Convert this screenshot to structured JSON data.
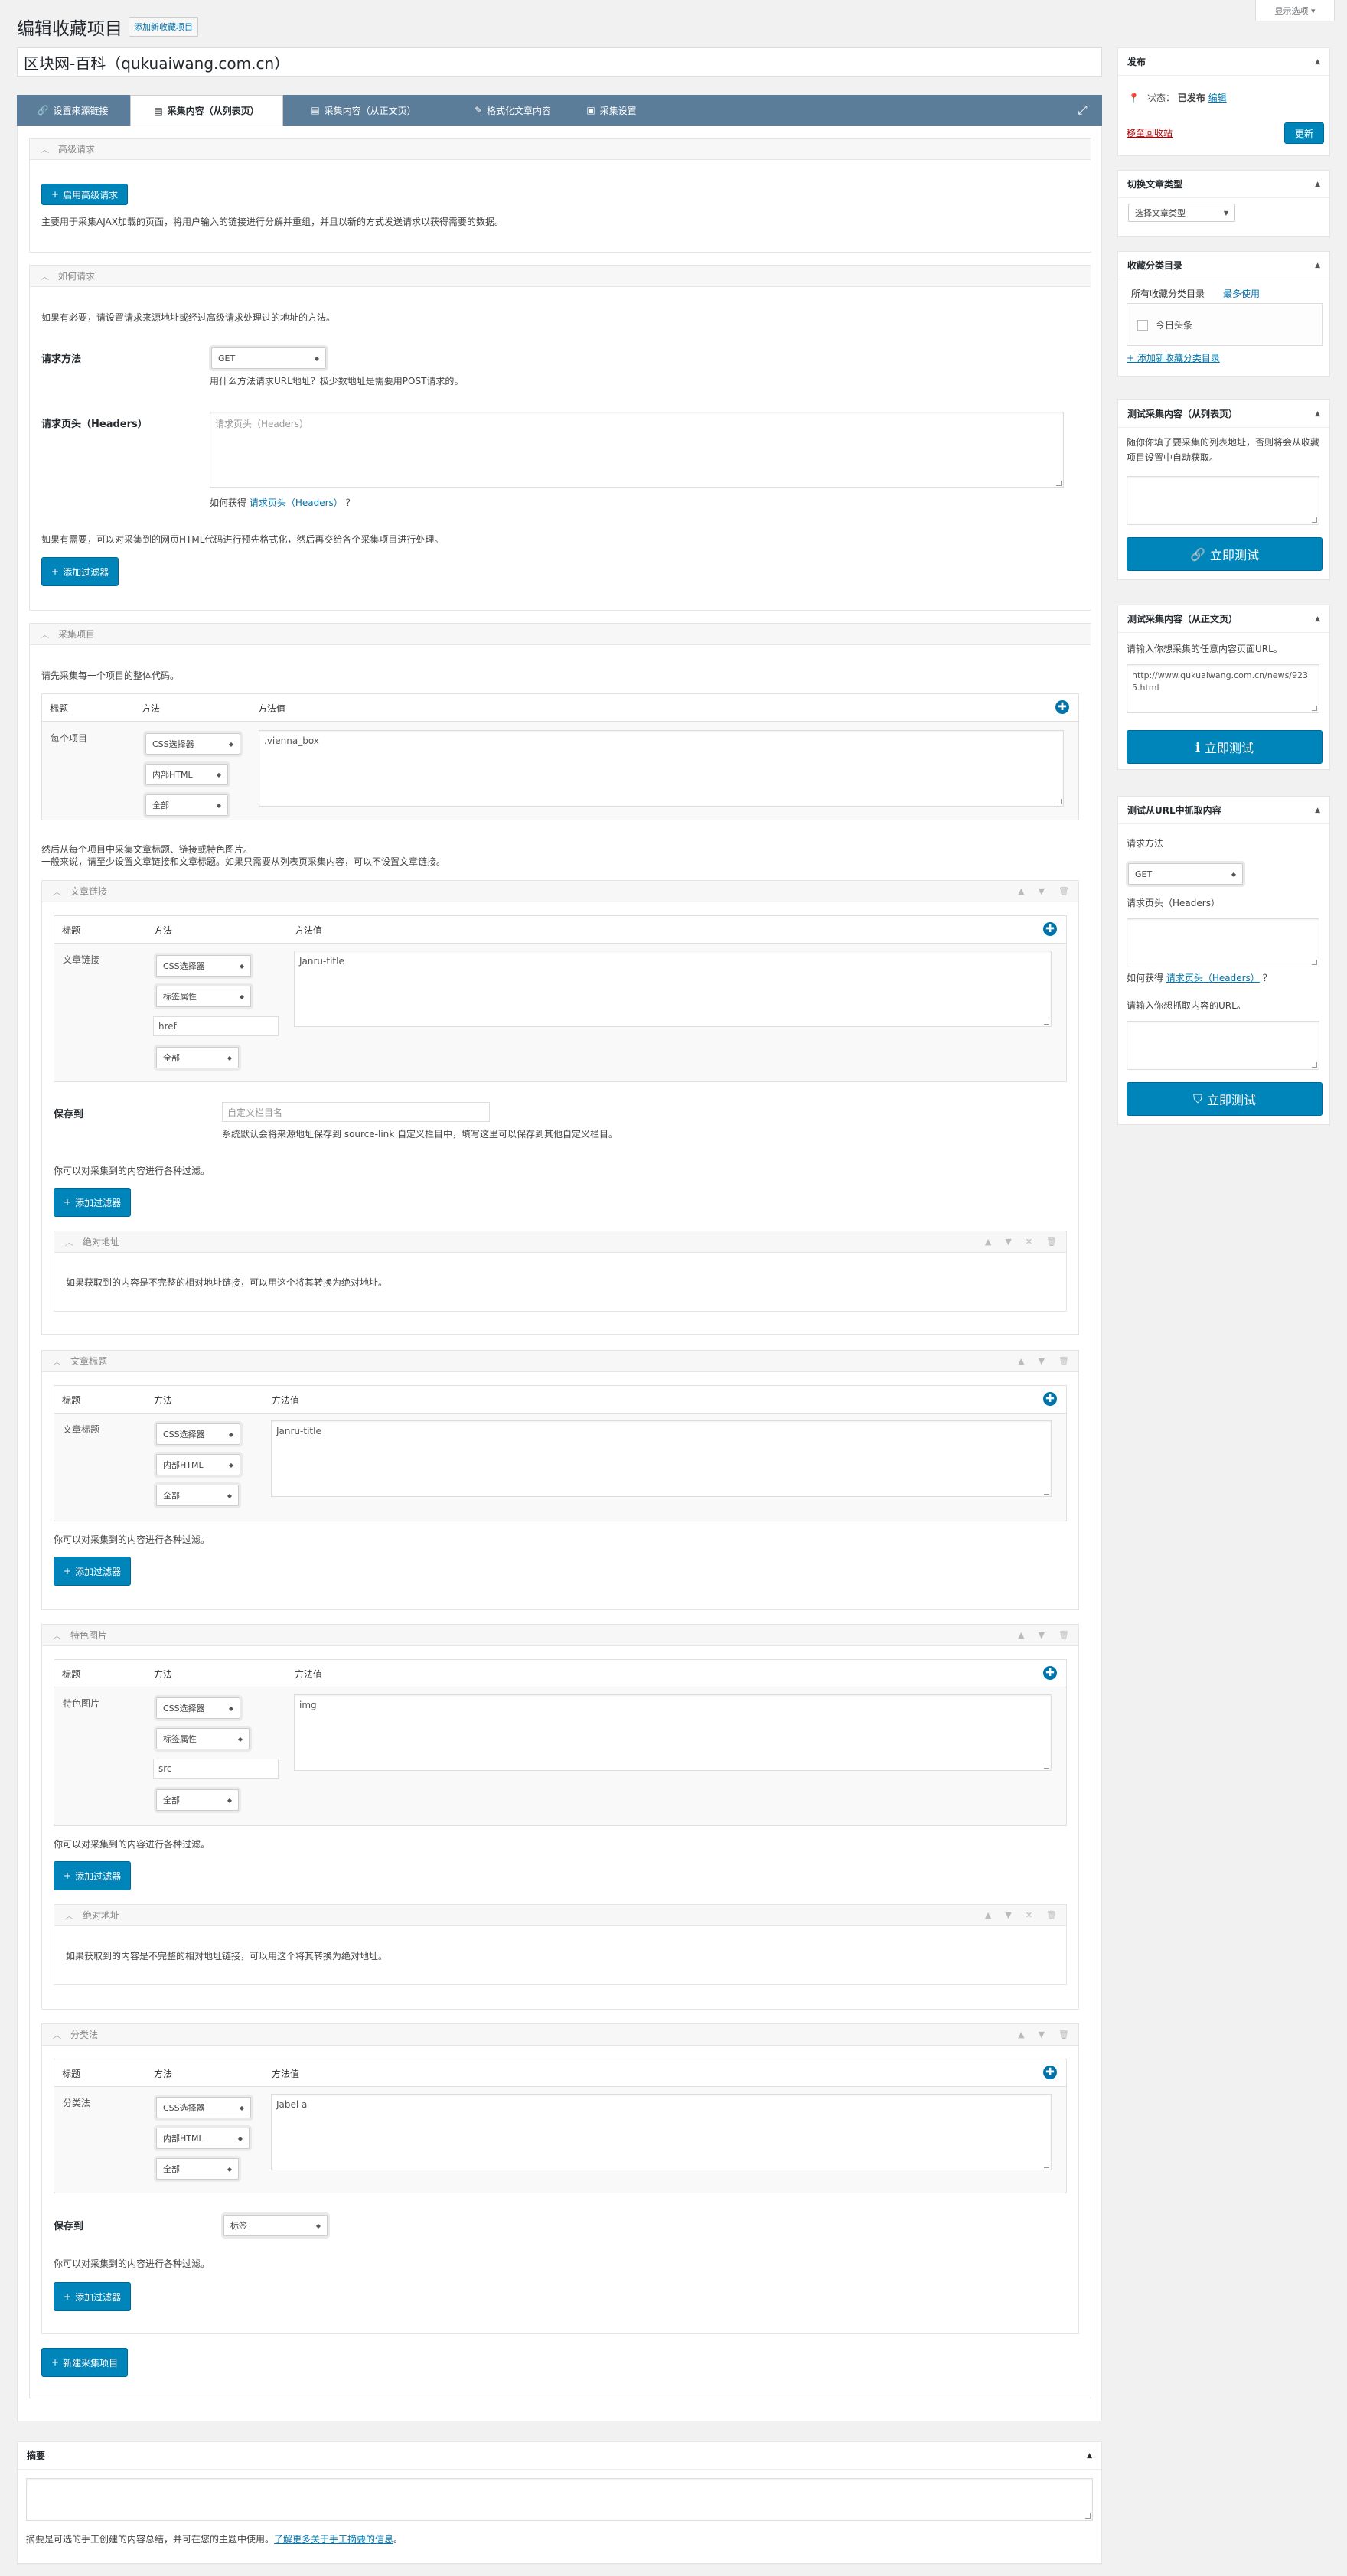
{
  "header": {
    "title": "编辑收藏项目",
    "add_new": "添加新收藏项目",
    "screen_options": "显示选项 ▾"
  },
  "post_title": "区块网-百科（qukuaiwang.com.cn）",
  "tabs": [
    {
      "icon": "🔗",
      "label": "设置来源链接"
    },
    {
      "icon": "▤",
      "label": "采集内容（从列表页）"
    },
    {
      "icon": "▤",
      "label": "采集内容（从正文页）"
    },
    {
      "icon": "✎",
      "label": "格式化文章内容"
    },
    {
      "icon": "▣",
      "label": "采集设置"
    }
  ],
  "advanced": {
    "header": "高级请求",
    "button": "启用高级请求",
    "desc": "主要用于采集AJAX加载的页面，将用户输入的链接进行分解并重组，并且以新的方式发送请求以获得需要的数据。"
  },
  "request": {
    "header": "如何请求",
    "intro": "如果有必要，请设置请求来源地址或经过高级请求处理过的地址的方法。",
    "method_label": "请求方法",
    "method_value": "GET",
    "method_help": "用什么方法请求URL地址？极少数地址是需要用POST请求的。",
    "headers_label": "请求页头（Headers）",
    "headers_placeholder": "请求页头（Headers）",
    "headers_help_pre": "如何获得",
    "headers_help_link": "请求页头（Headers）",
    "headers_help_post": "？",
    "filter_desc": "如果有需要，可以对采集到的网页HTML代码进行预先格式化，然后再交给各个采集项目进行处理。",
    "filter_btn": "添加过滤器"
  },
  "items": {
    "header": "采集项目",
    "intro": "请先采集每一个项目的整体代码。",
    "col_title": "标题",
    "col_method": "方法",
    "col_value": "方法值",
    "row_label": "每个项目",
    "sel1": "CSS选择器",
    "sel2": "内部HTML",
    "sel3": "全部",
    "value": ".vienna_box",
    "after1": "然后从每个项目中采集文章标题、链接或特色图片。",
    "after2": "一般来说，请至少设置文章链接和文章标题。如果只需要从列表页采集内容，可以不设置文章链接。"
  },
  "link": {
    "header": "文章链接",
    "row_label": "文章链接",
    "sel1": "CSS选择器",
    "sel2": "标签属性",
    "attr": "href",
    "sel3": "全部",
    "value": "Janru-title",
    "save_label": "保存到",
    "save_placeholder": "自定义栏目名",
    "save_help": "系统默认会将来源地址保存到 source-link 自定义栏目中，填写这里可以保存到其他自定义栏目。",
    "filter_desc": "你可以对采集到的内容进行各种过滤。",
    "filter_btn": "添加过滤器",
    "abs_header": "绝对地址",
    "abs_desc": "如果获取到的内容是不完整的相对地址链接，可以用这个将其转换为绝对地址。"
  },
  "title": {
    "header": "文章标题",
    "row_label": "文章标题",
    "sel1": "CSS选择器",
    "sel2": "内部HTML",
    "sel3": "全部",
    "value": "Janru-title",
    "filter_desc": "你可以对采集到的内容进行各种过滤。",
    "filter_btn": "添加过滤器"
  },
  "image": {
    "header": "特色图片",
    "row_label": "特色图片",
    "sel1": "CSS选择器",
    "sel2": "标签属性",
    "attr": "src",
    "sel3": "全部",
    "value": "img",
    "filter_desc": "你可以对采集到的内容进行各种过滤。",
    "filter_btn": "添加过滤器",
    "abs_header": "绝对地址",
    "abs_desc": "如果获取到的内容是不完整的相对地址链接，可以用这个将其转换为绝对地址。"
  },
  "cat": {
    "header": "分类法",
    "row_label": "分类法",
    "sel1": "CSS选择器",
    "sel2": "内部HTML",
    "sel3": "全部",
    "value": "Jabel a",
    "save_label": "保存到",
    "save_value": "标签",
    "filter_desc": "你可以对采集到的内容进行各种过滤。",
    "filter_btn": "添加过滤器"
  },
  "new_item_btn": "新建采集项目",
  "excerpt": {
    "header": "摘要",
    "help_pre": "摘要是可选的手工创建的内容总结，并可在您的主题中使用。",
    "help_link": "了解更多关于手工摘要的信息",
    "help_post": "。"
  },
  "sidebar": {
    "publish": {
      "header": "发布",
      "status_label": "状态：",
      "status_value": "已发布",
      "edit": "编辑",
      "trash": "移至回收站",
      "update": "更新"
    },
    "type": {
      "header": "切换文章类型",
      "value": "选择文章类型"
    },
    "cats": {
      "header": "收藏分类目录",
      "tab_all": "所有收藏分类目录",
      "tab_most": "最多使用",
      "item": "今日头条",
      "add": "+ 添加新收藏分类目录"
    },
    "test_list": {
      "header": "测试采集内容（从列表页）",
      "desc": "随你你填了要采集的列表地址，否则将会从收藏项目设置中自动获取。",
      "btn": "立即测试"
    },
    "test_content": {
      "header": "测试采集内容（从正文页）",
      "desc": "请输入你想采集的任意内容页面URL。",
      "value": "http://www.qukuaiwang.com.cn/news/9235.html",
      "btn": "立即测试"
    },
    "test_url": {
      "header": "测试从URL中抓取内容",
      "method_label": "请求方法",
      "method_value": "GET",
      "headers_label": "请求页头（Headers）",
      "help_pre": "如何获得",
      "help_link": "请求页头（Headers）",
      "help_post": "？",
      "url_label": "请输入你想抓取内容的URL。",
      "btn": "立即测试"
    }
  }
}
